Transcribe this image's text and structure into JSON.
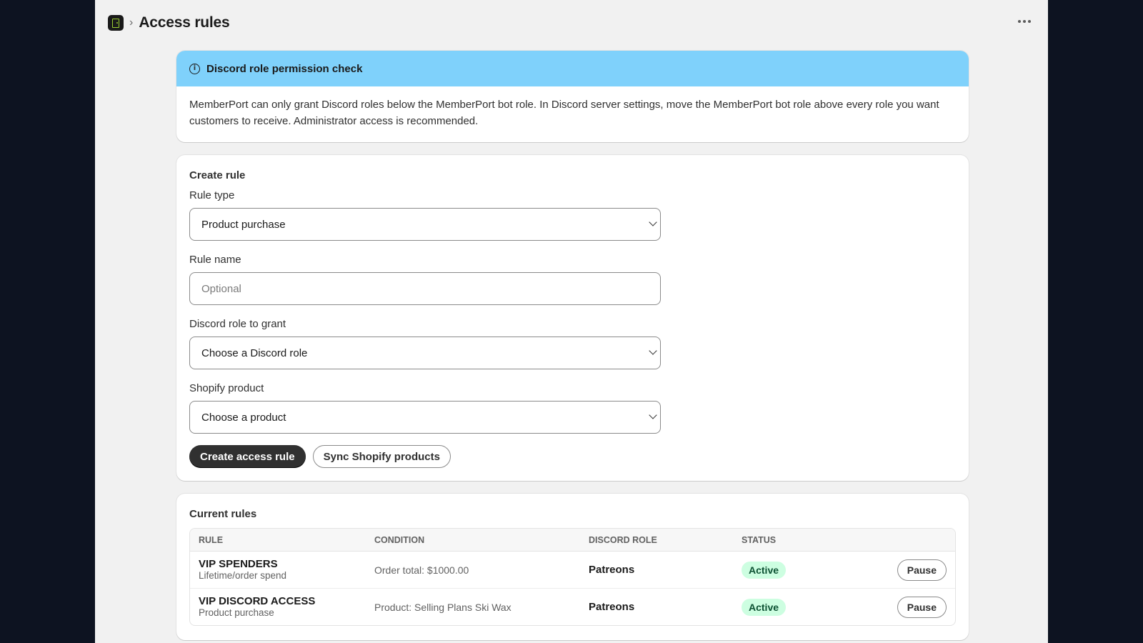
{
  "header": {
    "breadcrumb_separator": "›",
    "title": "Access rules",
    "app_icon": "door-icon",
    "more_icon": "more-horizontal-icon"
  },
  "banner": {
    "icon": "info-icon",
    "title": "Discord role permission check",
    "body": "MemberPort can only grant Discord roles below the MemberPort bot role. In Discord server settings, move the MemberPort bot role above every role you want customers to receive. Administrator access is recommended.",
    "color": "#7fd1fb"
  },
  "create_rule": {
    "title": "Create rule",
    "rule_type_label": "Rule type",
    "rule_type_value": "Product purchase",
    "rule_name_label": "Rule name",
    "rule_name_placeholder": "Optional",
    "discord_role_label": "Discord role to grant",
    "discord_role_value": "Choose a Discord role",
    "shopify_product_label": "Shopify product",
    "shopify_product_value": "Choose a product",
    "create_button": "Create access rule",
    "sync_button": "Sync Shopify products"
  },
  "current_rules": {
    "title": "Current rules",
    "columns": [
      "RULE",
      "CONDITION",
      "DISCORD ROLE",
      "STATUS"
    ],
    "rows": [
      {
        "name": "VIP SPENDERS",
        "type": "Lifetime/order spend",
        "condition": "Order total: $1000.00",
        "role": "Patreons",
        "status": "Active",
        "action": "Pause"
      },
      {
        "name": "VIP DISCORD ACCESS",
        "type": "Product purchase",
        "condition": "Product: Selling Plans Ski Wax",
        "role": "Patreons",
        "status": "Active",
        "action": "Pause"
      }
    ]
  }
}
